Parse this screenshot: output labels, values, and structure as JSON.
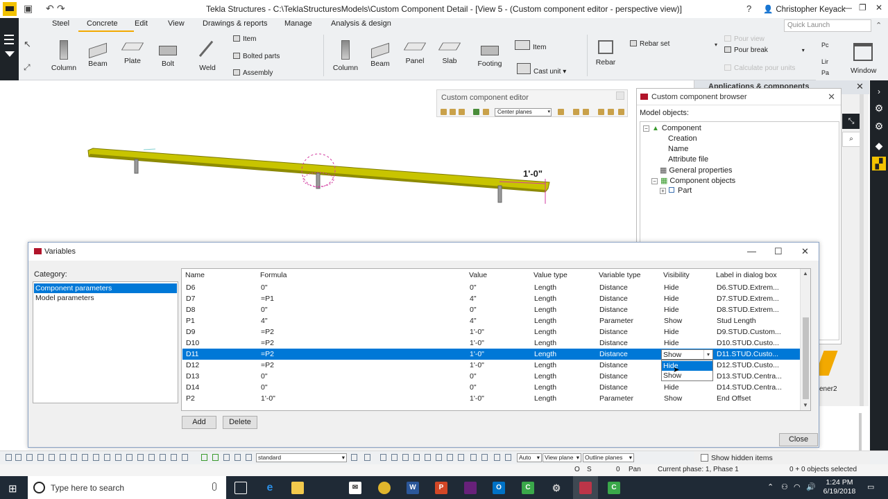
{
  "window": {
    "title": "Tekla Structures - C:\\TeklaStructuresModels\\Custom Component Detail  - [View 5 - (Custom component editor - perspective view)]",
    "help": "?",
    "user": "Christopher Keyack"
  },
  "ribbon": {
    "tabs": [
      "Steel",
      "Concrete",
      "Edit",
      "View",
      "Drawings & reports",
      "Manage",
      "Analysis & design"
    ],
    "active_tab": "Concrete",
    "quick_launch_placeholder": "Quick Launch",
    "steel_tools": [
      "Column",
      "Beam",
      "Plate",
      "Bolt",
      "Weld"
    ],
    "steel_small": [
      "Item",
      "Bolted parts",
      "Assembly"
    ],
    "concrete_tools": [
      "Column",
      "Beam",
      "Panel",
      "Slab",
      "Footing"
    ],
    "concrete_small": [
      "Item",
      "Cast unit"
    ],
    "rebar": "Rebar",
    "rebar_set": "Rebar set",
    "pour_view": "Pour view",
    "pour_break": "Pour break",
    "calculate_pour_units": "Calculate pour units",
    "window": "Window",
    "right_cut": [
      "Pc",
      "Lir",
      "Pa"
    ]
  },
  "viewport": {
    "dimension_label": "1'-0\""
  },
  "custom_component_editor": {
    "title": "Custom component editor",
    "plane_select": "Center planes"
  },
  "component_browser": {
    "title": "Custom component browser",
    "model_objects_label": "Model objects:",
    "tree": {
      "root": "Component",
      "children": [
        "Creation",
        "Name",
        "Attribute file",
        "General properties",
        "Component objects"
      ],
      "grandchild": "Part"
    }
  },
  "applications_panel": {
    "title": "Applications & components",
    "partial_close": "ose",
    "partial_item": "ener2"
  },
  "variables_dialog": {
    "title": "Variables",
    "category_label": "Category:",
    "categories": [
      "Component parameters",
      "Model parameters"
    ],
    "selected_category": "Component parameters",
    "columns": [
      "Name",
      "Formula",
      "Value",
      "Value type",
      "Variable type",
      "Visibility",
      "Label in dialog box"
    ],
    "rows": [
      [
        "D6",
        "0\"",
        "0\"",
        "Length",
        "Distance",
        "Hide",
        "D6.STUD.Extrem..."
      ],
      [
        "D7",
        "=P1",
        "4\"",
        "Length",
        "Distance",
        "Hide",
        "D7.STUD.Extrem..."
      ],
      [
        "D8",
        "0\"",
        "0\"",
        "Length",
        "Distance",
        "Hide",
        "D8.STUD.Extrem..."
      ],
      [
        "P1",
        "4\"",
        "4\"",
        "Length",
        "Parameter",
        "Show",
        "Stud Length"
      ],
      [
        "D9",
        "=P2",
        "1'-0\"",
        "Length",
        "Distance",
        "Hide",
        "D9.STUD.Custom..."
      ],
      [
        "D10",
        "=P2",
        "1'-0\"",
        "Length",
        "Distance",
        "Hide",
        "D10.STUD.Custo..."
      ],
      [
        "D11",
        "=P2",
        "1'-0\"",
        "Length",
        "Distance",
        "Show",
        "D11.STUD.Custo..."
      ],
      [
        "D12",
        "=P2",
        "1'-0\"",
        "Length",
        "Distance",
        "Hide",
        "D12.STUD.Custo..."
      ],
      [
        "D13",
        "0\"",
        "0\"",
        "Length",
        "Distance",
        "Hide",
        "D13.STUD.Centra..."
      ],
      [
        "D14",
        "0\"",
        "0\"",
        "Length",
        "Distance",
        "Hide",
        "D14.STUD.Centra..."
      ],
      [
        "P2",
        "1'-0\"",
        "1'-0\"",
        "Length",
        "Parameter",
        "Show",
        "End Offset"
      ]
    ],
    "selected_row": 6,
    "visibility_dropdown": {
      "value": "Show",
      "options": [
        "Hide",
        "Show"
      ],
      "highlighted": "Hide"
    },
    "buttons": {
      "add": "Add",
      "delete": "Delete",
      "close": "Close"
    }
  },
  "bottom_toolbar": {
    "standard_select": "standard",
    "auto_select": "Auto",
    "view_plane_select": "View plane",
    "outline_planes_select": "Outline planes",
    "show_hidden_items": "Show hidden items"
  },
  "status_bar": {
    "o": "O",
    "s": "S",
    "zero": "0",
    "pan": "Pan",
    "phase": "Current phase: 1, Phase 1",
    "selection": "0 + 0 objects selected"
  },
  "taskbar": {
    "search_placeholder": "Type here to search",
    "time": "1:24 PM",
    "date": "6/19/2018"
  },
  "colors": {
    "accent_tab": "#f2a900",
    "selection": "#0078d7",
    "beam": "#c8c400",
    "taskbar": "#1f2a36"
  }
}
